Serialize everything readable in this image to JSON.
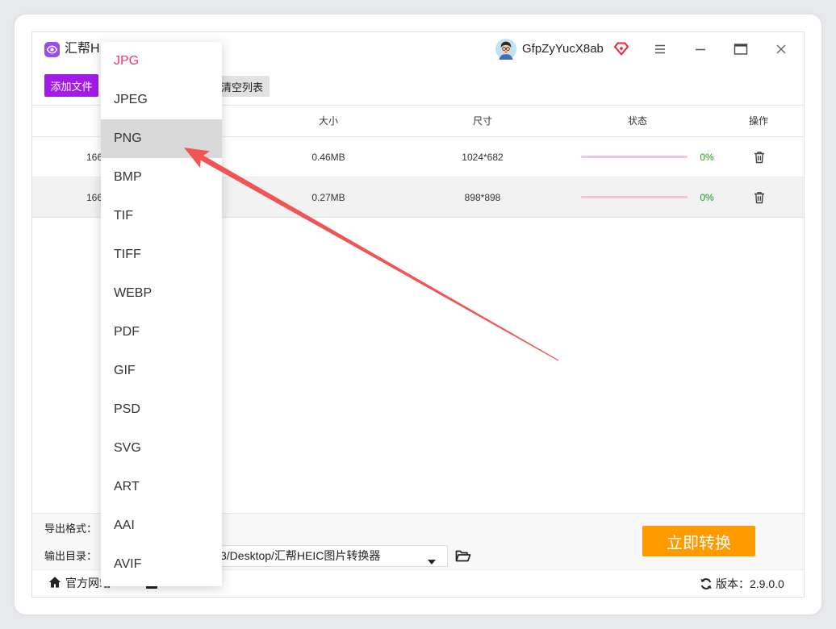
{
  "app": {
    "title": "汇帮HI",
    "user_name": "GfpZyYucX8ab"
  },
  "icons": [
    "app-logo-icon",
    "avatar",
    "vip-gem-icon",
    "menu-icon",
    "minimize-icon",
    "maximize-icon",
    "close-icon",
    "delete-icon",
    "chevron-down-icon",
    "folder-icon",
    "home-icon",
    "refresh-icon"
  ],
  "toolbar": {
    "add_files": "添加文件",
    "clear_list": "清空列表"
  },
  "table": {
    "headers": {
      "size": "大小",
      "dimensions": "尺寸",
      "status": "状态",
      "actions": "操作"
    },
    "rows": [
      {
        "name": "166",
        "size": "0.46MB",
        "dimensions": "1024*682",
        "progress": 0,
        "status": "0%"
      },
      {
        "name": "166",
        "size": "0.27MB",
        "dimensions": "898*898",
        "progress": 0,
        "status": "0%"
      }
    ]
  },
  "settings": {
    "export_format_label": "导出格式：",
    "output_dir_label": "输出目录：",
    "output_dir_value": "3/Desktop/汇帮HEIC图片转换器"
  },
  "actions": {
    "convert": "立即转换"
  },
  "footer": {
    "website": "官方网站",
    "version_label": "版本：",
    "version": "2.9.0.0"
  },
  "format_dropdown": {
    "options": [
      "JPG",
      "JPEG",
      "PNG",
      "BMP",
      "TIF",
      "TIFF",
      "WEBP",
      "PDF",
      "GIF",
      "PSD",
      "SVG",
      "ART",
      "AAI",
      "AVIF"
    ],
    "selected_index": 0,
    "highlighted_index": 2
  },
  "colors": {
    "accent": "#a21be6",
    "orange": "#ff9a00",
    "selected": "#e8386d",
    "hover": "#d9d9d9",
    "track": "#f7c4d3",
    "ok": "#1a9a1a",
    "arrow": "#f05454"
  }
}
